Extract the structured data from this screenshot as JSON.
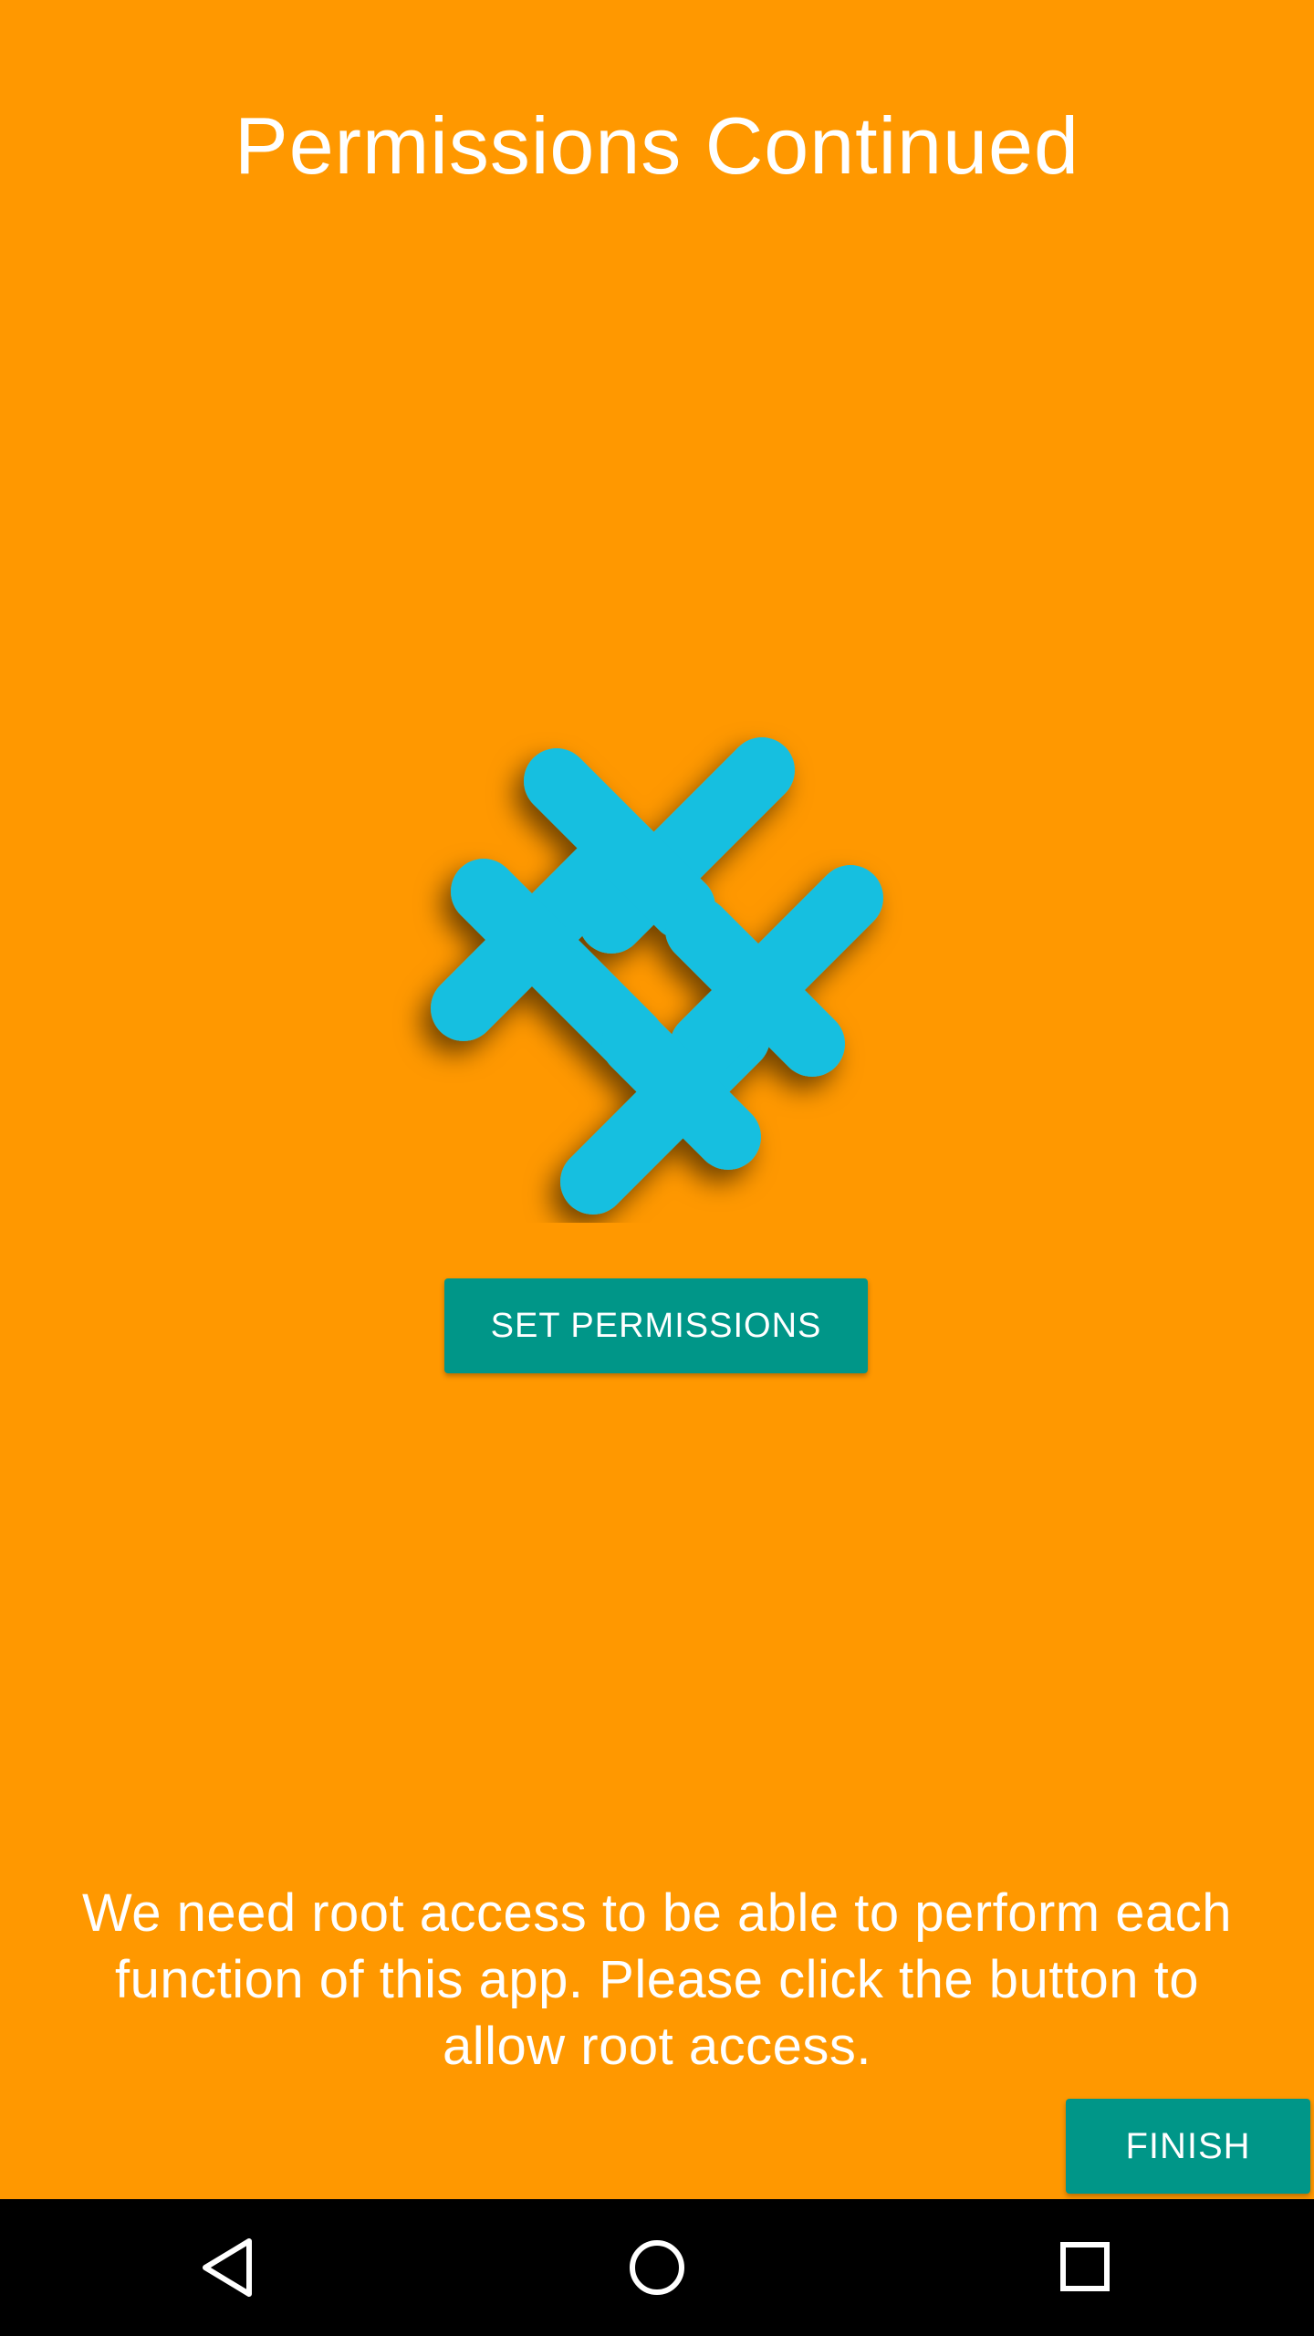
{
  "screen": {
    "title": "Permissions Continued",
    "logo_icon": "hashtag-logo-icon",
    "set_permissions_label": "SET PERMISSIONS",
    "message": "We need root access to be able to perform each function of this app. Please click the button to allow root access.",
    "finish_label": "FINISH"
  },
  "colors": {
    "background": "#FF9800",
    "button": "#009688",
    "logo": "#14BFE0",
    "navbar": "#000000"
  },
  "navbar": {
    "back_icon": "back-triangle-icon",
    "home_icon": "home-circle-icon",
    "recents_icon": "recents-square-icon"
  }
}
